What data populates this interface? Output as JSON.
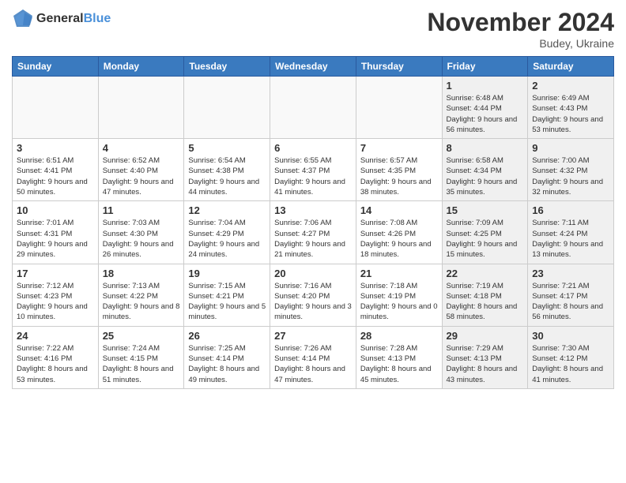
{
  "header": {
    "logo_line1": "General",
    "logo_line2": "Blue",
    "title": "November 2024",
    "location": "Budey, Ukraine"
  },
  "days_of_week": [
    "Sunday",
    "Monday",
    "Tuesday",
    "Wednesday",
    "Thursday",
    "Friday",
    "Saturday"
  ],
  "weeks": [
    [
      {
        "day": "",
        "info": "",
        "empty": true
      },
      {
        "day": "",
        "info": "",
        "empty": true
      },
      {
        "day": "",
        "info": "",
        "empty": true
      },
      {
        "day": "",
        "info": "",
        "empty": true
      },
      {
        "day": "",
        "info": "",
        "empty": true
      },
      {
        "day": "1",
        "info": "Sunrise: 6:48 AM\nSunset: 4:44 PM\nDaylight: 9 hours and 56 minutes.",
        "gray": true
      },
      {
        "day": "2",
        "info": "Sunrise: 6:49 AM\nSunset: 4:43 PM\nDaylight: 9 hours and 53 minutes.",
        "gray": true
      }
    ],
    [
      {
        "day": "3",
        "info": "Sunrise: 6:51 AM\nSunset: 4:41 PM\nDaylight: 9 hours and 50 minutes."
      },
      {
        "day": "4",
        "info": "Sunrise: 6:52 AM\nSunset: 4:40 PM\nDaylight: 9 hours and 47 minutes."
      },
      {
        "day": "5",
        "info": "Sunrise: 6:54 AM\nSunset: 4:38 PM\nDaylight: 9 hours and 44 minutes."
      },
      {
        "day": "6",
        "info": "Sunrise: 6:55 AM\nSunset: 4:37 PM\nDaylight: 9 hours and 41 minutes."
      },
      {
        "day": "7",
        "info": "Sunrise: 6:57 AM\nSunset: 4:35 PM\nDaylight: 9 hours and 38 minutes."
      },
      {
        "day": "8",
        "info": "Sunrise: 6:58 AM\nSunset: 4:34 PM\nDaylight: 9 hours and 35 minutes.",
        "gray": true
      },
      {
        "day": "9",
        "info": "Sunrise: 7:00 AM\nSunset: 4:32 PM\nDaylight: 9 hours and 32 minutes.",
        "gray": true
      }
    ],
    [
      {
        "day": "10",
        "info": "Sunrise: 7:01 AM\nSunset: 4:31 PM\nDaylight: 9 hours and 29 minutes."
      },
      {
        "day": "11",
        "info": "Sunrise: 7:03 AM\nSunset: 4:30 PM\nDaylight: 9 hours and 26 minutes."
      },
      {
        "day": "12",
        "info": "Sunrise: 7:04 AM\nSunset: 4:29 PM\nDaylight: 9 hours and 24 minutes."
      },
      {
        "day": "13",
        "info": "Sunrise: 7:06 AM\nSunset: 4:27 PM\nDaylight: 9 hours and 21 minutes."
      },
      {
        "day": "14",
        "info": "Sunrise: 7:08 AM\nSunset: 4:26 PM\nDaylight: 9 hours and 18 minutes."
      },
      {
        "day": "15",
        "info": "Sunrise: 7:09 AM\nSunset: 4:25 PM\nDaylight: 9 hours and 15 minutes.",
        "gray": true
      },
      {
        "day": "16",
        "info": "Sunrise: 7:11 AM\nSunset: 4:24 PM\nDaylight: 9 hours and 13 minutes.",
        "gray": true
      }
    ],
    [
      {
        "day": "17",
        "info": "Sunrise: 7:12 AM\nSunset: 4:23 PM\nDaylight: 9 hours and 10 minutes."
      },
      {
        "day": "18",
        "info": "Sunrise: 7:13 AM\nSunset: 4:22 PM\nDaylight: 9 hours and 8 minutes."
      },
      {
        "day": "19",
        "info": "Sunrise: 7:15 AM\nSunset: 4:21 PM\nDaylight: 9 hours and 5 minutes."
      },
      {
        "day": "20",
        "info": "Sunrise: 7:16 AM\nSunset: 4:20 PM\nDaylight: 9 hours and 3 minutes."
      },
      {
        "day": "21",
        "info": "Sunrise: 7:18 AM\nSunset: 4:19 PM\nDaylight: 9 hours and 0 minutes."
      },
      {
        "day": "22",
        "info": "Sunrise: 7:19 AM\nSunset: 4:18 PM\nDaylight: 8 hours and 58 minutes.",
        "gray": true
      },
      {
        "day": "23",
        "info": "Sunrise: 7:21 AM\nSunset: 4:17 PM\nDaylight: 8 hours and 56 minutes.",
        "gray": true
      }
    ],
    [
      {
        "day": "24",
        "info": "Sunrise: 7:22 AM\nSunset: 4:16 PM\nDaylight: 8 hours and 53 minutes."
      },
      {
        "day": "25",
        "info": "Sunrise: 7:24 AM\nSunset: 4:15 PM\nDaylight: 8 hours and 51 minutes."
      },
      {
        "day": "26",
        "info": "Sunrise: 7:25 AM\nSunset: 4:14 PM\nDaylight: 8 hours and 49 minutes."
      },
      {
        "day": "27",
        "info": "Sunrise: 7:26 AM\nSunset: 4:14 PM\nDaylight: 8 hours and 47 minutes."
      },
      {
        "day": "28",
        "info": "Sunrise: 7:28 AM\nSunset: 4:13 PM\nDaylight: 8 hours and 45 minutes."
      },
      {
        "day": "29",
        "info": "Sunrise: 7:29 AM\nSunset: 4:13 PM\nDaylight: 8 hours and 43 minutes.",
        "gray": true
      },
      {
        "day": "30",
        "info": "Sunrise: 7:30 AM\nSunset: 4:12 PM\nDaylight: 8 hours and 41 minutes.",
        "gray": true
      }
    ]
  ]
}
